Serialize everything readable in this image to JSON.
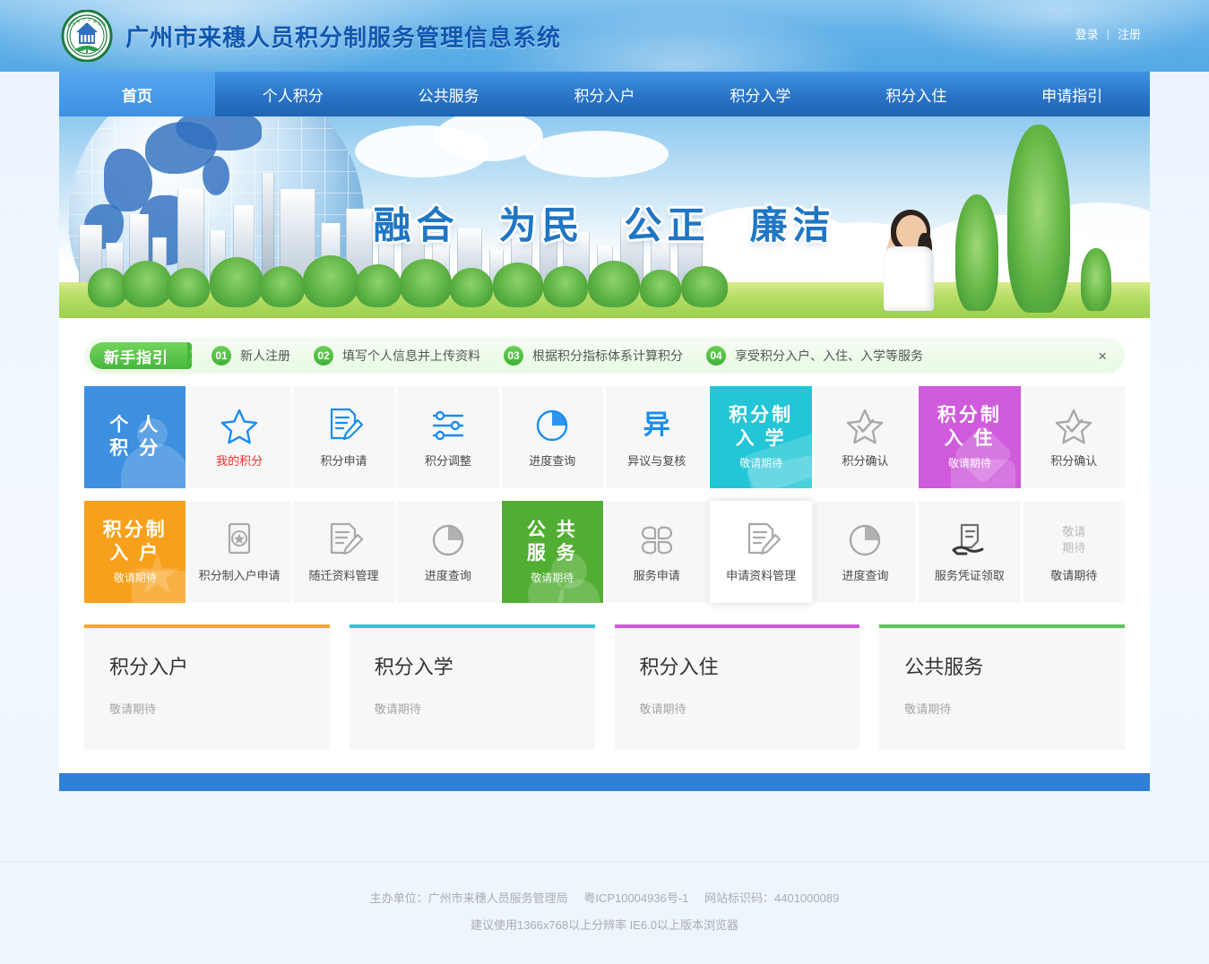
{
  "header": {
    "logo_alt": "广州市来穗人员服务管理局徽标",
    "title": "广州市来穗人员积分制服务管理信息系统",
    "login_label": "登录",
    "separator": "|",
    "register_label": "注册"
  },
  "nav": {
    "items": [
      {
        "label": "首页",
        "active": true
      },
      {
        "label": "个人积分",
        "active": false
      },
      {
        "label": "公共服务",
        "active": false
      },
      {
        "label": "积分入户",
        "active": false
      },
      {
        "label": "积分入学",
        "active": false
      },
      {
        "label": "积分入住",
        "active": false
      },
      {
        "label": "申请指引",
        "active": false
      }
    ]
  },
  "banner": {
    "slogan_1": "融合",
    "slogan_2": "为民",
    "slogan_3": "公正",
    "slogan_4": "廉洁"
  },
  "guide": {
    "badge": "新手指引",
    "steps": [
      {
        "num": "01",
        "text": "新人注册"
      },
      {
        "num": "02",
        "text": "填写个人信息并上传资料"
      },
      {
        "num": "03",
        "text": "根据积分指标体系计算积分"
      },
      {
        "num": "04",
        "text": "享受积分入户、入住、入学等服务"
      }
    ],
    "close": "×"
  },
  "tiles": {
    "row1": [
      {
        "kind": "category",
        "color": "blue",
        "title_line1": "个 人",
        "title_line2": "积 分",
        "sub": "",
        "icon": "person-silhouette-icon",
        "name": "category-personal-points"
      },
      {
        "kind": "item",
        "label": "我的积分",
        "icon": "star-icon",
        "style": "red",
        "name": "tile-my-points"
      },
      {
        "kind": "item",
        "label": "积分申请",
        "icon": "document-edit-icon",
        "style": "blue",
        "name": "tile-points-application"
      },
      {
        "kind": "item",
        "label": "积分调整",
        "icon": "sliders-icon",
        "style": "blue",
        "name": "tile-points-adjustment"
      },
      {
        "kind": "item",
        "label": "进度查询",
        "icon": "pie-chart-icon",
        "style": "blue",
        "name": "tile-progress-query-1"
      },
      {
        "kind": "item",
        "label": "异议与复核",
        "icon": "yi-character-icon",
        "style": "blue",
        "name": "tile-objection-review"
      },
      {
        "kind": "category",
        "color": "teal",
        "title_line1": "积分制",
        "title_line2": "入 学",
        "sub": "敬请期待",
        "icon": "book-layers-icon",
        "name": "category-points-schooling"
      },
      {
        "kind": "item",
        "label": "积分确认",
        "icon": "star-check-icon",
        "style": "gray",
        "name": "tile-points-confirm-school"
      },
      {
        "kind": "category",
        "color": "purple",
        "title_line1": "积分制",
        "title_line2": "入 住",
        "sub": "敬请期待",
        "icon": "house-icon",
        "name": "category-points-housing"
      },
      {
        "kind": "item",
        "label": "积分确认",
        "icon": "star-check-icon",
        "style": "gray",
        "name": "tile-points-confirm-housing"
      }
    ],
    "row2": [
      {
        "kind": "category",
        "color": "orange",
        "title_line1": "积分制",
        "title_line2": "入 户",
        "sub": "敬请期待",
        "icon": "star-badge-icon",
        "name": "category-points-residency"
      },
      {
        "kind": "item",
        "label": "积分制入户申请",
        "icon": "id-card-star-icon",
        "style": "gray",
        "name": "tile-residency-application"
      },
      {
        "kind": "item",
        "label": "随迁资料管理",
        "icon": "document-edit-icon",
        "style": "gray",
        "name": "tile-dependent-documents"
      },
      {
        "kind": "item",
        "label": "进度查询",
        "icon": "pie-chart-icon",
        "style": "gray",
        "name": "tile-progress-query-2"
      },
      {
        "kind": "category",
        "color": "green",
        "title_line1": "公 共",
        "title_line2": "服 务",
        "sub": "敬请期待",
        "icon": "clover-icon",
        "name": "category-public-service"
      },
      {
        "kind": "item",
        "label": "服务申请",
        "icon": "grid-apps-icon",
        "style": "gray",
        "name": "tile-service-application"
      },
      {
        "kind": "item",
        "label": "申请资料管理",
        "icon": "document-edit-icon",
        "style": "gray",
        "hovered": true,
        "name": "tile-application-documents"
      },
      {
        "kind": "item",
        "label": "进度查询",
        "icon": "pie-chart-icon",
        "style": "gray",
        "name": "tile-progress-query-3"
      },
      {
        "kind": "item",
        "label": "服务凭证领取",
        "icon": "hand-document-icon",
        "style": "gray",
        "name": "tile-service-voucher"
      },
      {
        "kind": "item",
        "label": "敬请期待",
        "icon": "coming-soon-text-icon",
        "icon_text_1": "敬请",
        "icon_text_2": "期待",
        "style": "muted-dark",
        "name": "tile-coming-soon"
      }
    ]
  },
  "cards": [
    {
      "title": "积分入户",
      "sub": "敬请期待",
      "accent": "#f5a623"
    },
    {
      "title": "积分入学",
      "sub": "敬请期待",
      "accent": "#2ec7d4"
    },
    {
      "title": "积分入住",
      "sub": "敬请期待",
      "accent": "#cf5bdc"
    },
    {
      "title": "公共服务",
      "sub": "敬请期待",
      "accent": "#5cc25b"
    }
  ],
  "footer": {
    "org_label": "主办单位：广州市来穗人员服务管理局",
    "icp": "粤ICP10004936号-1",
    "site_code": "网站标识码：4401000089",
    "browser_note": "建议使用1366x768以上分辨率 IE6.0以上版本浏览器"
  },
  "colors": {
    "brand_blue": "#1057b0",
    "nav_blue": "#2a74c8",
    "accent_red": "#e8312a",
    "panel_bar": "#3080d8"
  }
}
